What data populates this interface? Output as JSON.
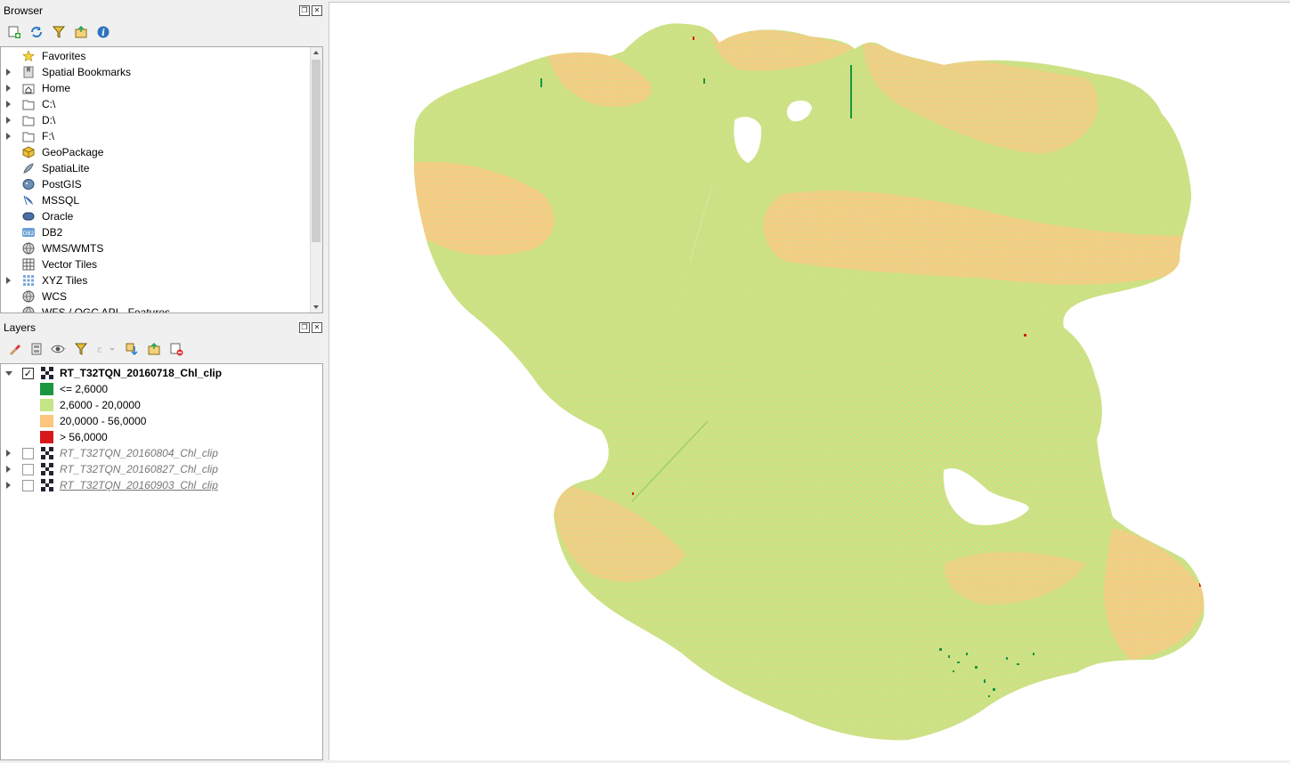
{
  "browser": {
    "title": "Browser",
    "items": [
      {
        "label": "Favorites",
        "icon": "star-icon",
        "expandable": false
      },
      {
        "label": "Spatial Bookmarks",
        "icon": "bookmark-icon",
        "expandable": true
      },
      {
        "label": "Home",
        "icon": "home-folder-icon",
        "expandable": true
      },
      {
        "label": "C:\\",
        "icon": "folder-icon",
        "expandable": true
      },
      {
        "label": "D:\\",
        "icon": "folder-icon",
        "expandable": true
      },
      {
        "label": "F:\\",
        "icon": "folder-icon",
        "expandable": true
      },
      {
        "label": "GeoPackage",
        "icon": "geopackage-icon",
        "expandable": false
      },
      {
        "label": "SpatiaLite",
        "icon": "spatialite-icon",
        "expandable": false
      },
      {
        "label": "PostGIS",
        "icon": "postgis-icon",
        "expandable": false
      },
      {
        "label": "MSSQL",
        "icon": "mssql-icon",
        "expandable": false
      },
      {
        "label": "Oracle",
        "icon": "oracle-icon",
        "expandable": false
      },
      {
        "label": "DB2",
        "icon": "db2-icon",
        "expandable": false
      },
      {
        "label": "WMS/WMTS",
        "icon": "globe-icon",
        "expandable": false
      },
      {
        "label": "Vector Tiles",
        "icon": "grid-icon",
        "expandable": false
      },
      {
        "label": "XYZ Tiles",
        "icon": "tiles-icon",
        "expandable": true
      },
      {
        "label": "WCS",
        "icon": "globe-icon",
        "expandable": false
      },
      {
        "label": "WFS / OGC API - Features",
        "icon": "globe-icon",
        "expandable": false
      }
    ]
  },
  "layers": {
    "title": "Layers",
    "active_layer": {
      "name": "RT_T32TQN_20160718_Chl_clip",
      "checked": true,
      "legend": [
        {
          "label": "<= 2,6000",
          "color": "#1a9641"
        },
        {
          "label": "2,6000 - 20,0000",
          "color": "#c4e687"
        },
        {
          "label": "20,0000 - 56,0000",
          "color": "#fdc57e"
        },
        {
          "label": "> 56,0000",
          "color": "#d7191c"
        }
      ]
    },
    "other_layers": [
      {
        "name": "RT_T32TQN_20160804_Chl_clip",
        "checked": false
      },
      {
        "name": "RT_T32TQN_20160827_Chl_clip",
        "checked": false
      },
      {
        "name": "RT_T32TQN_20160903_Chl_clip",
        "checked": false
      }
    ]
  },
  "map": {
    "colors": {
      "low": "#1a9641",
      "mid": "#c8e384",
      "high": "#f9c985",
      "veryhigh": "#d7191c"
    }
  }
}
